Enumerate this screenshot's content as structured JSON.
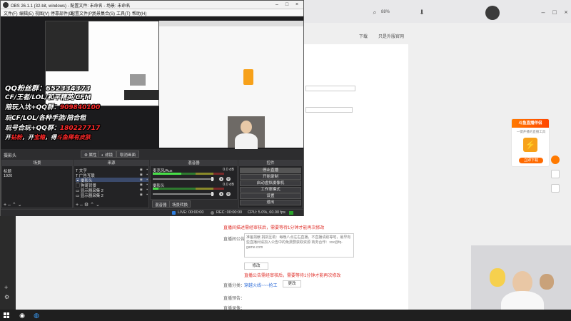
{
  "obs": {
    "title": "OBS 26.1.1 (32-bit, windows) - 配置文件: 未命名 - 场景: 未命名",
    "menu": [
      "文件(F)",
      "编辑(E)",
      "视图(V)",
      "停靠部件(D)",
      "配置文件(P)",
      "场景集合(S)",
      "工具(T)",
      "帮助(H)"
    ],
    "scene_label": "摄影头",
    "top_buttons": {
      "properties": "属性",
      "filters": "滤镜",
      "desktop_audio": "取消画面"
    },
    "panels": {
      "scenes": "场景",
      "sources": "来源",
      "mixer": "混音器",
      "controls": "控件"
    },
    "scenes": [
      "标题",
      "1920"
    ],
    "sources": [
      "文字",
      "广告互联",
      "摄影头",
      "狗哥背景",
      "显示器采集 2",
      "显示器采集 2"
    ],
    "mixer": [
      {
        "name": "麦克风/Aux",
        "db": "0.0 dB"
      },
      {
        "name": "摄影头",
        "db": "0.0 dB"
      }
    ],
    "controls": [
      "停止直播",
      "开始录制",
      "启动虚拟摄像机",
      "工作室模式",
      "设置",
      "退出"
    ],
    "mixer_buttons": [
      "混音器",
      "场景转换"
    ],
    "status": {
      "live": "LIVE: 00:00:00",
      "rec": "REC: 00:00:00",
      "cpu": "CPU: 5.0%, 60.00 fps"
    }
  },
  "promo": {
    "line1": "QQ粉丝群：652334373",
    "line2": "CF/王者/LOL/和平精英/CFM",
    "line3_label": "陪玩入坑+QQ群：",
    "line3_num": "909840100",
    "line4": "玩CF/LOL/各种手游/陪合租",
    "line5_label": "玩号合玩+QQ群：",
    "line5_num": "180227717",
    "line6_a": "开",
    "line6_b": "钻粉",
    "line6_c": "，开",
    "line6_d": "宝箱",
    "line6_e": "，得",
    "line6_f": "斗鱼稀有皮肤"
  },
  "browser": {
    "panel_title": "直播间公告：",
    "announcement_text": "准备捐献 捐捐互助：每晚八点左右直播，不直播请别等吧，最早有些直播间请加入公告中的免费群获取资源 商务合作：xxx@fq-game.com",
    "modify_button": "修改",
    "warning_text": "直播公告需经审核后，需要等待1分钟才能再次修改",
    "category_label": "直播分类：",
    "category_value": "穿越火线~~~抢工",
    "change_button": "更改",
    "live_label": "直播预告：",
    "replay_label": "直播录像：",
    "info_red": "直播间描述需经审核后，需要等待1分钟才能再次修改",
    "download_label": "下载",
    "user_label": "只是外服官网"
  },
  "ad": {
    "header": "斗鱼直播伴侣",
    "sub": "一键开播的直播工具",
    "button": "立即下载"
  },
  "colors": {
    "accent": "#ff6a00",
    "obs_bg": "#2d2d2f",
    "promo_red": "#ff2a2a"
  }
}
